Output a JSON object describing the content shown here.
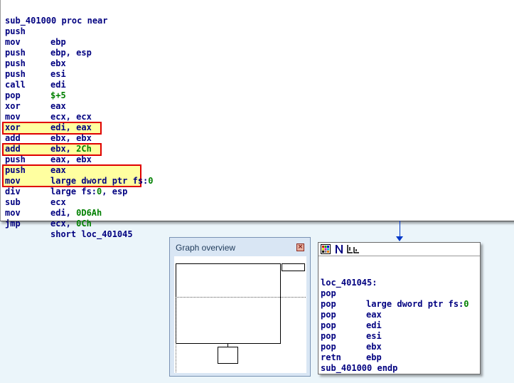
{
  "main_block": {
    "lines": [
      {
        "mnemonic": "sub_401000 proc near",
        "operand": ""
      },
      {
        "mnemonic": "push",
        "operand": "ebp"
      },
      {
        "mnemonic": "mov",
        "operand": "ebp, esp"
      },
      {
        "mnemonic": "push",
        "operand": "ebx"
      },
      {
        "mnemonic": "push",
        "operand": "esi"
      },
      {
        "mnemonic": "push",
        "operand": "edi"
      },
      {
        "mnemonic": "call",
        "operand": "$+5"
      },
      {
        "mnemonic": "pop",
        "operand": "eax"
      },
      {
        "mnemonic": "xor",
        "operand": "ecx, ecx"
      },
      {
        "mnemonic": "mov",
        "operand": "edi, eax"
      },
      {
        "mnemonic": "xor",
        "operand": "ebx, ebx"
      },
      {
        "mnemonic": "add",
        "operand": "ebx, ",
        "num": "2Ch"
      },
      {
        "mnemonic": "add",
        "operand": "eax, ebx"
      },
      {
        "mnemonic": "push",
        "operand": "eax"
      },
      {
        "mnemonic": "push",
        "operand": "large dword ptr fs:",
        "num": "0"
      },
      {
        "mnemonic": "mov",
        "operand": "large fs:",
        "num": "0",
        "operand_tail": ", esp"
      },
      {
        "mnemonic": "div",
        "operand": "ecx"
      },
      {
        "mnemonic": "sub",
        "operand": "edi, ",
        "num": "0D6Ah"
      },
      {
        "mnemonic": "mov",
        "operand": "ecx, ",
        "num": "0Ch"
      },
      {
        "mnemonic": "jmp",
        "operand": "short loc_401045"
      }
    ]
  },
  "overview": {
    "title": "Graph overview"
  },
  "end_block": {
    "lines": [
      {
        "mnemonic": "loc_401045:",
        "operand": ""
      },
      {
        "mnemonic": "pop",
        "operand": "large dword ptr fs:",
        "num": "0"
      },
      {
        "mnemonic": "pop",
        "operand": "eax"
      },
      {
        "mnemonic": "pop",
        "operand": "edi"
      },
      {
        "mnemonic": "pop",
        "operand": "esi"
      },
      {
        "mnemonic": "pop",
        "operand": "ebx"
      },
      {
        "mnemonic": "pop",
        "operand": "ebp"
      },
      {
        "mnemonic": "retn",
        "operand": ""
      },
      {
        "mnemonic": "sub_401000 endp",
        "operand": ""
      }
    ]
  },
  "colors": {
    "highlight_fill": "#ffffa0",
    "highlight_border": "#e00000",
    "edge": "#0038c8",
    "code": "#000080",
    "number": "#008000"
  }
}
